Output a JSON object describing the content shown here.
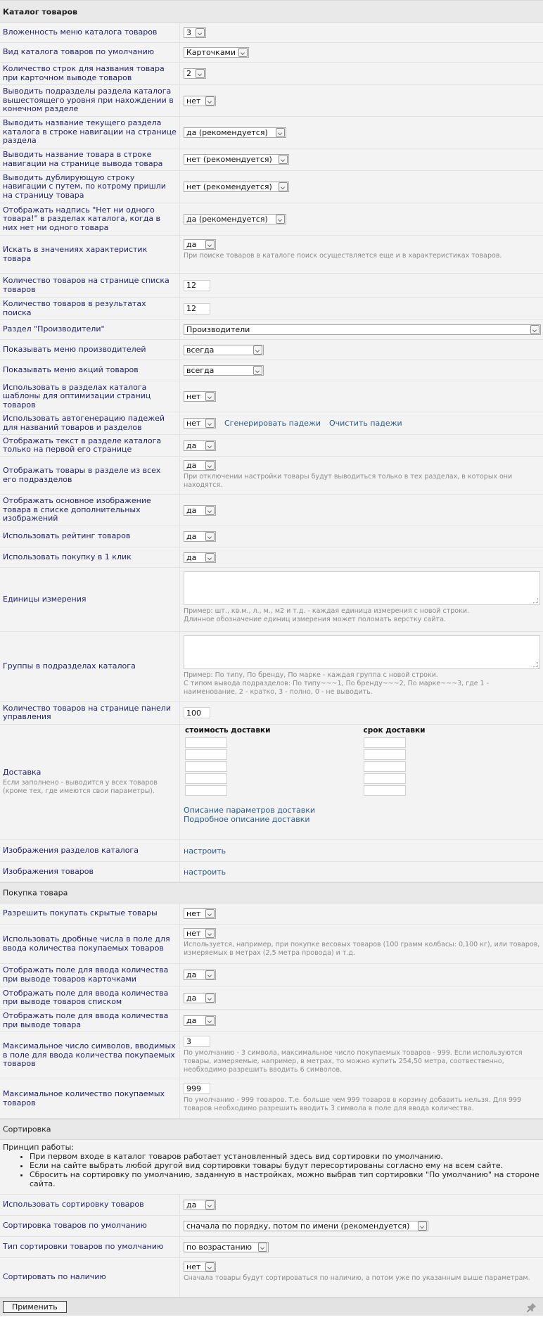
{
  "sections": {
    "catalog": "Каталог товаров",
    "purchase": "Покупка товара",
    "sorting": "Сортировка"
  },
  "rows": {
    "nesting": {
      "label": "Вложенность меню каталога товаров",
      "value": "3"
    },
    "view": {
      "label": "Вид каталога товаров по умолчанию",
      "value": "Карточками"
    },
    "name_lines": {
      "label": "Количество строк для названия товара при карточном выводе товаров",
      "value": "2"
    },
    "parent_sub": {
      "label": "Выводить подразделы раздела каталога вышестоящего уровня при нахождении в конечном разделе",
      "value": "нет"
    },
    "crumb_section": {
      "label": "Выводить название текущего раздела каталога в строке навигации на странице раздела",
      "value": "да (рекомендуется)"
    },
    "crumb_product": {
      "label": "Выводить название товара в строке навигации на странице вывода товара",
      "value": "нет (рекомендуется)"
    },
    "dup_path": {
      "label": "Выводить дублирующую строку навигации с путем, по котрому пришли на страницу товара",
      "value": "нет (рекомендуется)"
    },
    "no_products": {
      "label": "Отображать надпись \"Нет ни одного товара!\" в разделах каталога, когда в них нет ни одного товара",
      "value": "да (рекомендуется)"
    },
    "search_chars": {
      "label": "Искать в значениях характеристик товара",
      "value": "да",
      "hint": "При поиске товаров в каталоге поиск осуществляется еще и в характеристиках товаров."
    },
    "per_page": {
      "label": "Количество товаров на странице списка товаров",
      "value": "12"
    },
    "search_results": {
      "label": "Количество товаров в результатах поиска",
      "value": "12"
    },
    "makers_section": {
      "label": "Раздел \"Производители\"",
      "value": "Производители"
    },
    "makers_menu": {
      "label": "Показывать меню производителей",
      "value": "всегда"
    },
    "promo_menu": {
      "label": "Показывать меню акций товаров",
      "value": "всегда"
    },
    "templates": {
      "label": "Использовать в разделах каталога шаблоны для оптимизации страниц товаров",
      "value": "нет"
    },
    "cases": {
      "label": "Использовать автогенерацию падежей для названий товаров и разделов",
      "value": "нет",
      "link1": "Сгенерировать падежи",
      "link2": "Очистить падежи"
    },
    "first_page_text": {
      "label": "Отображать текст в разделе каталога только на первой его странице",
      "value": "да"
    },
    "sub_products": {
      "label": "Отображать товары в разделе из всех его подразделов",
      "value": "да",
      "hint": "При отключении настройки товары будут выводиться только в тех разделах, в которых они находятся."
    },
    "main_image": {
      "label": "Отображать основное изображение товара в списке дополнительных изображений",
      "value": "да"
    },
    "rating": {
      "label": "Использовать рейтинг товаров",
      "value": "да"
    },
    "one_click": {
      "label": "Использовать покупку в 1 клик",
      "value": "да"
    },
    "units": {
      "label": "Единицы измерения",
      "hint1": "Пример: шт., кв.м., л., м., м2 и т.д. - каждая единица измерения с новой строки.",
      "hint2": "Длинное обозначение единиц измерения может поломать верстку сайта."
    },
    "groups": {
      "label": "Группы в подразделах каталога",
      "hint1": "Пример: По типу, По бренду, По марке - каждая группа с новой строки.",
      "hint2": "С типом вывода подразделов: По типу~~~1, По бренду~~~2, По марке~~~3, где 1 - наименование, 2 - кратко, 3 - полно, 0 - не выводить."
    },
    "admin_per_page": {
      "label": "Количество товаров на странице панели управления",
      "value": "100"
    },
    "delivery": {
      "label": "Доставка",
      "sub": "Если заполнено - выводится у всех товаров (кроме тех, где имеются свои параметры).",
      "col1": "стоимость доставки",
      "col2": "срок доставки",
      "link1": "Описание параметров доставки",
      "link2": "Подробное описание доставки"
    },
    "section_images": {
      "label": "Изображения разделов каталога",
      "link": "настроить"
    },
    "product_images": {
      "label": "Изображения товаров",
      "link": "настроить"
    },
    "hidden_buy": {
      "label": "Разрешить покупать скрытые товары",
      "value": "нет"
    },
    "fractional": {
      "label": "Использовать дробные числа в поле для ввода количества покупаемых товаров",
      "value": "нет",
      "hint": "Используется, например, при покупке весовых товаров (100 грамм колбасы: 0,100 кг), или товаров, измеряемых в метрах (2,5 метра провода) и т.д."
    },
    "qty_cards": {
      "label": "Отображать поле для ввода количества при выводе товаров карточками",
      "value": "да"
    },
    "qty_list": {
      "label": "Отображать поле для ввода количества при выводе товаров списком",
      "value": "да"
    },
    "qty_product": {
      "label": "Отображать поле для ввода количества при выводе товара",
      "value": "да"
    },
    "max_chars": {
      "label": "Максимальное число символов, вводимых в поле для ввода количества покупаемых товаров",
      "value": "3",
      "hint": "По умолчанию - 3 символа, максимальное число покупаемых товаров - 999. Если используются товары, измеряемые, например, в метрах, то можно купить 254,50 метра, соотвественно, необходимо разрешить вводить 6 символов."
    },
    "max_qty": {
      "label": "Максимальное количество покупаемых товаров",
      "value": "999",
      "hint": "По умолчанию - 999 товаров. Т.е. больше чем 999 товаров в корзину добавить нельзя. Для 999 товаров необходимо разрешить вводить 3 символа в поле для ввода количества."
    },
    "use_sort": {
      "label": "Использовать сортировку товаров",
      "value": "да"
    },
    "sort_default": {
      "label": "Сортировка товаров по умолчанию",
      "value": "сначала по порядку, потом по имени (рекомендуется)"
    },
    "sort_type": {
      "label": "Тип сортировки товаров по умолчанию",
      "value": "по возрастанию"
    },
    "sort_stock": {
      "label": "Сортировать по наличию",
      "value": "нет",
      "hint": "Сначала товары будут сортироваться по наличию, а потом уже по указанным выше параметрам."
    }
  },
  "sorting_info": {
    "title": "Принцип работы:",
    "items": [
      "При первом входе в каталог товаров работает установленный здесь вид сортировки по умолчанию.",
      "Если на сайте выбрать любой другой вид сортировки товары будут пересортированы согласно ему на всем сайте.",
      "Сбросить на сортировку по умолчанию, заданную в настройках, можно выбрав тип сортировки \"По умолчанию\" на стороне сайта."
    ]
  },
  "apply_button": "Применить"
}
